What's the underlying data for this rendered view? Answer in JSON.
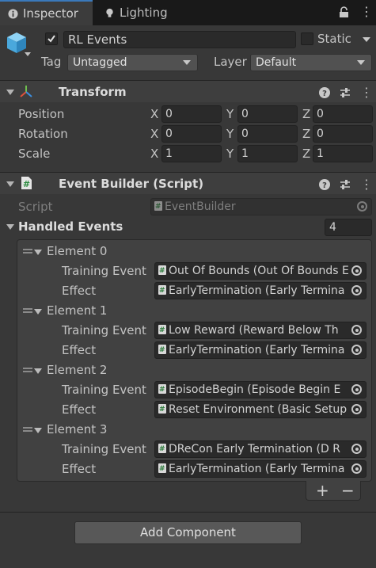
{
  "tabs": [
    {
      "label": "Inspector"
    },
    {
      "label": "Lighting"
    }
  ],
  "gameobject": {
    "name": "RL Events",
    "static_label": "Static",
    "tag_label": "Tag",
    "tag_value": "Untagged",
    "layer_label": "Layer",
    "layer_value": "Default"
  },
  "transform": {
    "title": "Transform",
    "rows": [
      {
        "label": "Position",
        "x": "0",
        "y": "0",
        "z": "0"
      },
      {
        "label": "Rotation",
        "x": "0",
        "y": "0",
        "z": "0"
      },
      {
        "label": "Scale",
        "x": "1",
        "y": "1",
        "z": "1"
      }
    ],
    "axis_x": "X",
    "axis_y": "Y",
    "axis_z": "Z"
  },
  "event_builder": {
    "title": "Event Builder (Script)",
    "script_label": "Script",
    "script_value": "EventBuilder",
    "handled_label": "Handled Events",
    "handled_count": "4",
    "elements": [
      {
        "label": "Element 0",
        "training_label": "Training Event",
        "training_value": "Out Of Bounds (Out Of Bounds E",
        "effect_label": "Effect",
        "effect_value": "EarlyTermination (Early Termina"
      },
      {
        "label": "Element 1",
        "training_label": "Training Event",
        "training_value": "Low Reward (Reward Below Th",
        "effect_label": "Effect",
        "effect_value": "EarlyTermination (Early Termina"
      },
      {
        "label": "Element 2",
        "training_label": "Training Event",
        "training_value": "EpisodeBegin (Episode Begin E",
        "effect_label": "Effect",
        "effect_value": "Reset Environment (Basic Setup"
      },
      {
        "label": "Element 3",
        "training_label": "Training Event",
        "training_value": "DReCon Early Termination (D R",
        "effect_label": "Effect",
        "effect_value": "EarlyTermination (Early Termina"
      }
    ],
    "add_label": "+",
    "remove_label": "−"
  },
  "add_component_label": "Add Component",
  "header_icons": {
    "help": "?",
    "presets": "⇵",
    "menu": "⋮"
  },
  "window_icons": {
    "lock": "🔒",
    "menu": "⋮"
  }
}
